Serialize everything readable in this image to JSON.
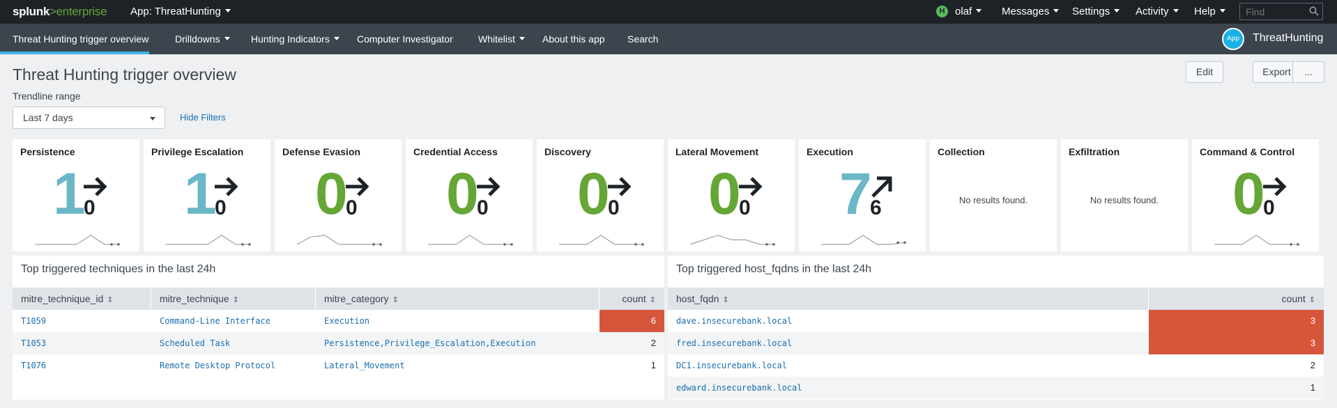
{
  "topbar": {
    "logo_main": "splunk",
    "logo_gt": ">",
    "logo_product": "enterprise",
    "app_menu": "App: ThreatHunting",
    "user_initial": "H",
    "user_name": "olaf",
    "menus": [
      "Messages",
      "Settings",
      "Activity",
      "Help"
    ],
    "find_placeholder": "Find"
  },
  "navbar": {
    "items": [
      {
        "label": "Threat Hunting trigger overview",
        "dropdown": false
      },
      {
        "label": "Drilldowns",
        "dropdown": true
      },
      {
        "label": "Hunting Indicators",
        "dropdown": true
      },
      {
        "label": "Computer Investigator",
        "dropdown": false
      },
      {
        "label": "Whitelist",
        "dropdown": true
      },
      {
        "label": "About this app",
        "dropdown": false
      },
      {
        "label": "Search",
        "dropdown": false
      }
    ],
    "app_badge": "App",
    "app_name": "ThreatHunting",
    "accent_color": "#3fb6e9"
  },
  "page": {
    "title": "Threat Hunting trigger overview",
    "edit_label": "Edit",
    "export_label": "Export",
    "more_label": "...",
    "filter_label": "Trendline range",
    "filter_value": "Last 7 days",
    "hide_filters": "Hide Filters"
  },
  "panels": [
    {
      "title": "Persistence",
      "value": "1",
      "delta": "0",
      "trend": "right",
      "color": "#6ab7c7",
      "spark": [
        0,
        0,
        0,
        0,
        1,
        0,
        0
      ]
    },
    {
      "title": "Privilege Escalation",
      "value": "1",
      "delta": "0",
      "trend": "right",
      "color": "#6ab7c7",
      "spark": [
        0,
        0,
        0,
        0,
        1,
        0,
        0
      ]
    },
    {
      "title": "Defense Evasion",
      "value": "0",
      "delta": "0",
      "trend": "right",
      "color": "#65a637",
      "spark": [
        0,
        1,
        1.2,
        0,
        0,
        0,
        0
      ]
    },
    {
      "title": "Credential Access",
      "value": "0",
      "delta": "0",
      "trend": "right",
      "color": "#65a637",
      "spark": [
        0,
        0,
        0,
        1,
        0,
        0,
        0
      ]
    },
    {
      "title": "Discovery",
      "value": "0",
      "delta": "0",
      "trend": "right",
      "color": "#65a637",
      "spark": [
        0,
        0,
        0,
        1,
        0,
        0,
        0
      ]
    },
    {
      "title": "Lateral Movement",
      "value": "0",
      "delta": "0",
      "trend": "right",
      "color": "#65a637",
      "spark": [
        0,
        0.6,
        1.2,
        0.6,
        0.6,
        0,
        0
      ]
    },
    {
      "title": "Execution",
      "value": "7",
      "delta": "6",
      "trend": "up",
      "color": "#6ab7c7",
      "spark": [
        0,
        0,
        0,
        1,
        0,
        0,
        0.2
      ]
    },
    {
      "title": "Collection",
      "empty": "No results found."
    },
    {
      "title": "Exfiltration",
      "empty": "No results found."
    },
    {
      "title": "Command & Control",
      "value": "0",
      "delta": "0",
      "trend": "right",
      "color": "#65a637",
      "spark": [
        0,
        0,
        0,
        1,
        0,
        0,
        0
      ]
    }
  ],
  "techniques": {
    "title": "Top triggered techniques in the last 24h",
    "columns": [
      "mitre_technique_id",
      "mitre_technique",
      "mitre_category",
      "count"
    ],
    "rows": [
      [
        "T1059",
        "Command-Line Interface",
        "Execution",
        "6"
      ],
      [
        "T1053",
        "Scheduled Task",
        "Persistence,Privilege_Escalation,Execution",
        "2"
      ],
      [
        "T1076",
        "Remote Desktop Protocol",
        "Lateral_Movement",
        "1"
      ]
    ]
  },
  "hosts": {
    "title": "Top triggered host_fqdns in the last 24h",
    "columns": [
      "host_fqdn",
      "count"
    ],
    "rows": [
      [
        "dave.insecurebank.local",
        "3"
      ],
      [
        "fred.insecurebank.local",
        "3"
      ],
      [
        "DC1.insecurebank.local",
        "2"
      ],
      [
        "edward.insecurebank.local",
        "1"
      ]
    ]
  },
  "colors": {
    "hot_cell": "#d6563c",
    "row_alt": "#f2f4f5"
  }
}
